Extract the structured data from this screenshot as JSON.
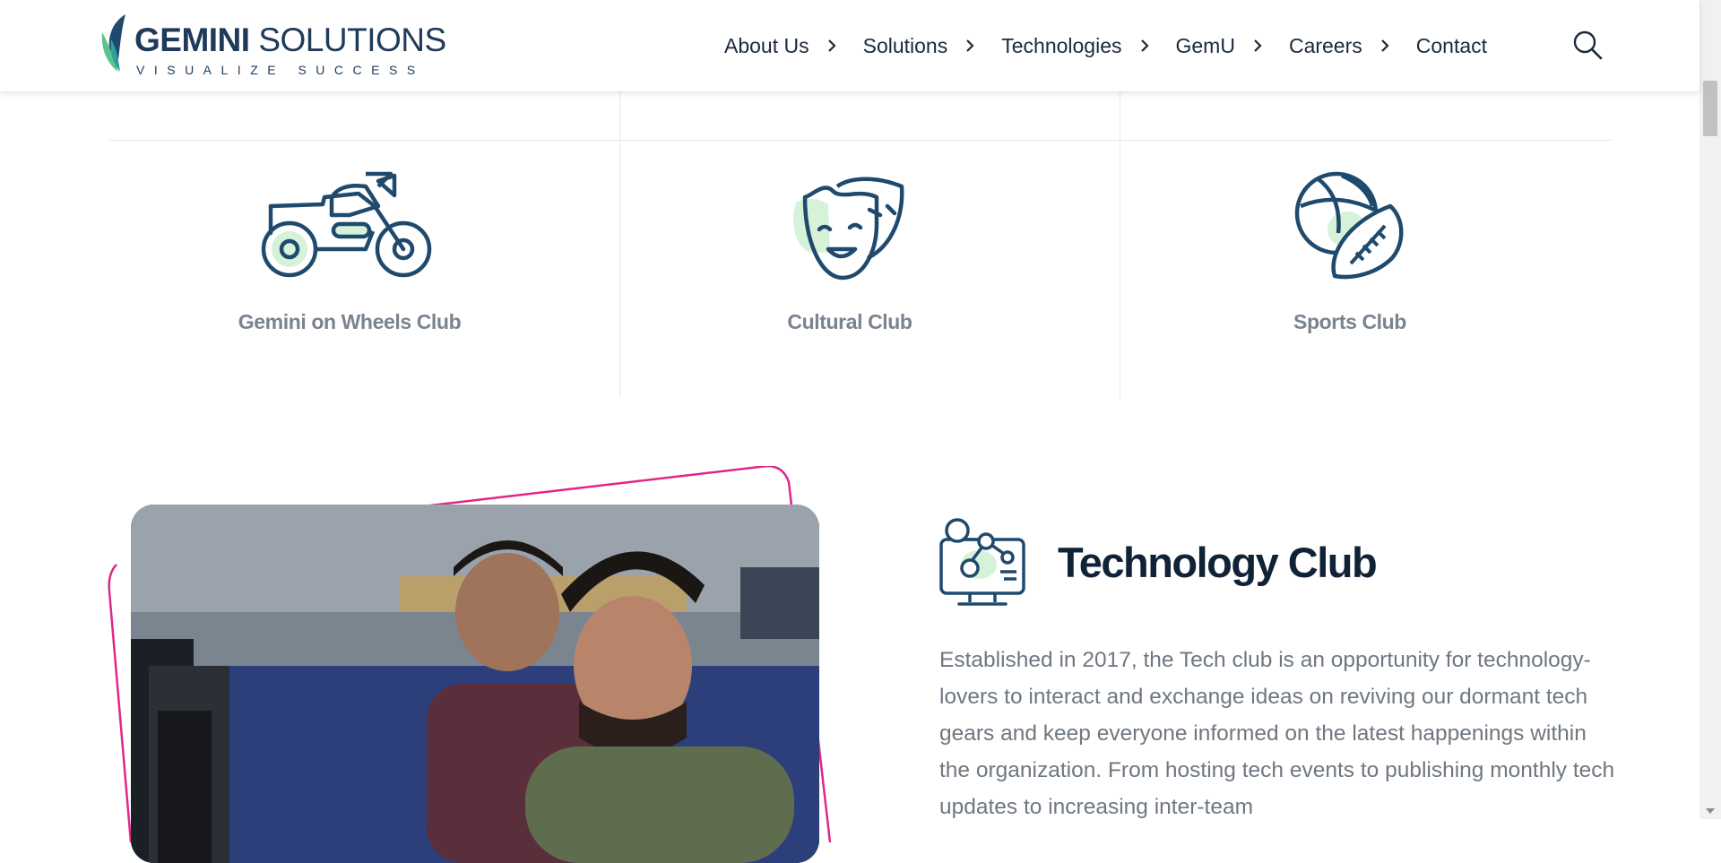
{
  "brand": {
    "name_bold": "GEMINI",
    "name_light": "SOLUTIONS",
    "tagline": "VISUALIZE SUCCESS"
  },
  "nav": {
    "items": [
      {
        "label": "About Us",
        "has_submenu": true
      },
      {
        "label": "Solutions",
        "has_submenu": true
      },
      {
        "label": "Technologies",
        "has_submenu": true
      },
      {
        "label": "GemU",
        "has_submenu": true
      },
      {
        "label": "Careers",
        "has_submenu": true
      },
      {
        "label": "Contact",
        "has_submenu": false
      }
    ],
    "search_icon": "search-icon"
  },
  "clubs": [
    {
      "label": "Gemini on Wheels Club",
      "icon": "motorcycle-icon"
    },
    {
      "label": "Cultural Club",
      "icon": "theater-masks-icon"
    },
    {
      "label": "Sports Club",
      "icon": "sports-balls-icon"
    }
  ],
  "tech_club": {
    "title": "Technology Club",
    "icon": "network-monitor-icon",
    "description": "Established in 2017, the Tech club is an opportunity for technology-lovers to interact and exchange ideas on reviving our dormant tech gears and keep everyone informed on the latest happenings within the organization. From hosting tech events to publishing monthly tech updates to increasing inter-team"
  },
  "colors": {
    "navy": "#1f4a6e",
    "accent_green": "#d6f2d9",
    "accent_pink": "#e0268a",
    "muted_text": "#7a8390"
  }
}
